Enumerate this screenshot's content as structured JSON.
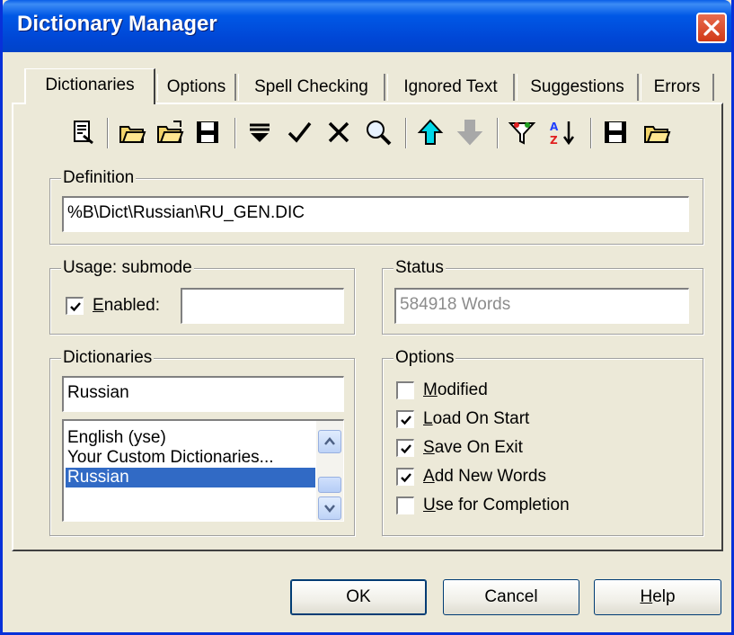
{
  "window": {
    "title": "Dictionary Manager"
  },
  "tabs": [
    {
      "label": "Dictionaries",
      "active": true
    },
    {
      "label": "Options"
    },
    {
      "label": "Spell Checking"
    },
    {
      "label": "Ignored Text"
    },
    {
      "label": "Suggestions"
    },
    {
      "label": "Errors"
    }
  ],
  "toolbar": {
    "icons": [
      "properties-icon",
      "open-folder-icon",
      "open-folder-alt-icon",
      "save-icon",
      "insert-icon",
      "check-icon",
      "delete-icon",
      "find-icon",
      "move-up-icon",
      "move-down-icon",
      "filter-icon",
      "sort-az-icon",
      "save-all-icon",
      "open-file-icon"
    ]
  },
  "definition": {
    "legend": "Definition",
    "value": "%B\\Dict\\Russian\\RU_GEN.DIC"
  },
  "usage": {
    "legend": "Usage: submode",
    "enabled_label_prefix": "E",
    "enabled_label_rest": "nabled:",
    "enabled_checked": true,
    "submode_value": ""
  },
  "status": {
    "legend": "Status",
    "value": "584918 Words"
  },
  "dictionaries": {
    "legend": "Dictionaries",
    "current": "Russian",
    "items": [
      {
        "label": "English (yse)"
      },
      {
        "label": "Your Custom Dictionaries..."
      },
      {
        "label": "Russian",
        "selected": true
      }
    ]
  },
  "options": {
    "legend": "Options",
    "items": [
      {
        "key": "M",
        "rest": "odified",
        "checked": false
      },
      {
        "key": "L",
        "rest": "oad On Start",
        "checked": true
      },
      {
        "key": "S",
        "rest": "ave On Exit",
        "checked": true
      },
      {
        "key": "A",
        "rest": "dd New Words",
        "checked": true
      },
      {
        "key": "U",
        "rest": "se for Completion",
        "checked": false
      }
    ]
  },
  "buttons": {
    "ok": "OK",
    "cancel": "Cancel",
    "help_key": "H",
    "help_rest": "elp"
  }
}
